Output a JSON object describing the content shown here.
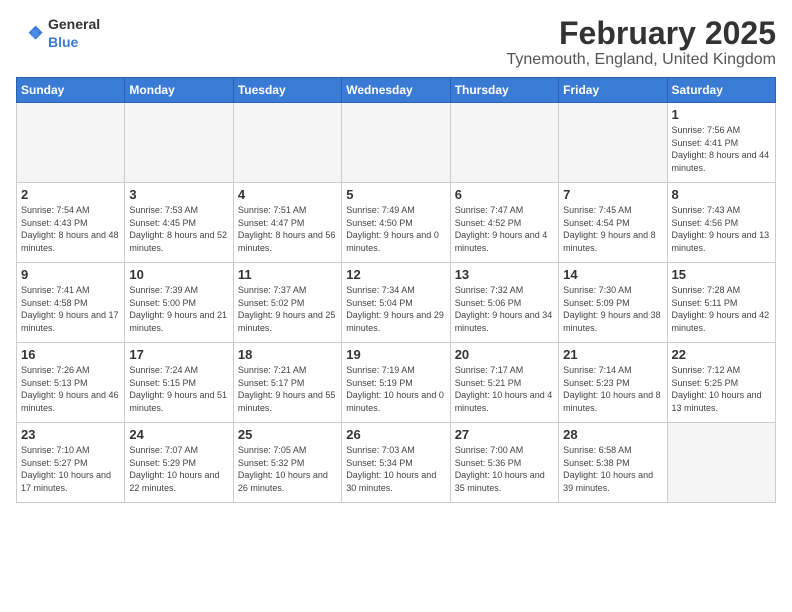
{
  "header": {
    "logo_general": "General",
    "logo_blue": "Blue",
    "title": "February 2025",
    "subtitle": "Tynemouth, England, United Kingdom"
  },
  "days_of_week": [
    "Sunday",
    "Monday",
    "Tuesday",
    "Wednesday",
    "Thursday",
    "Friday",
    "Saturday"
  ],
  "weeks": [
    [
      {
        "day": "",
        "info": ""
      },
      {
        "day": "",
        "info": ""
      },
      {
        "day": "",
        "info": ""
      },
      {
        "day": "",
        "info": ""
      },
      {
        "day": "",
        "info": ""
      },
      {
        "day": "",
        "info": ""
      },
      {
        "day": "1",
        "info": "Sunrise: 7:56 AM\nSunset: 4:41 PM\nDaylight: 8 hours and 44 minutes."
      }
    ],
    [
      {
        "day": "2",
        "info": "Sunrise: 7:54 AM\nSunset: 4:43 PM\nDaylight: 8 hours and 48 minutes."
      },
      {
        "day": "3",
        "info": "Sunrise: 7:53 AM\nSunset: 4:45 PM\nDaylight: 8 hours and 52 minutes."
      },
      {
        "day": "4",
        "info": "Sunrise: 7:51 AM\nSunset: 4:47 PM\nDaylight: 8 hours and 56 minutes."
      },
      {
        "day": "5",
        "info": "Sunrise: 7:49 AM\nSunset: 4:50 PM\nDaylight: 9 hours and 0 minutes."
      },
      {
        "day": "6",
        "info": "Sunrise: 7:47 AM\nSunset: 4:52 PM\nDaylight: 9 hours and 4 minutes."
      },
      {
        "day": "7",
        "info": "Sunrise: 7:45 AM\nSunset: 4:54 PM\nDaylight: 9 hours and 8 minutes."
      },
      {
        "day": "8",
        "info": "Sunrise: 7:43 AM\nSunset: 4:56 PM\nDaylight: 9 hours and 13 minutes."
      }
    ],
    [
      {
        "day": "9",
        "info": "Sunrise: 7:41 AM\nSunset: 4:58 PM\nDaylight: 9 hours and 17 minutes."
      },
      {
        "day": "10",
        "info": "Sunrise: 7:39 AM\nSunset: 5:00 PM\nDaylight: 9 hours and 21 minutes."
      },
      {
        "day": "11",
        "info": "Sunrise: 7:37 AM\nSunset: 5:02 PM\nDaylight: 9 hours and 25 minutes."
      },
      {
        "day": "12",
        "info": "Sunrise: 7:34 AM\nSunset: 5:04 PM\nDaylight: 9 hours and 29 minutes."
      },
      {
        "day": "13",
        "info": "Sunrise: 7:32 AM\nSunset: 5:06 PM\nDaylight: 9 hours and 34 minutes."
      },
      {
        "day": "14",
        "info": "Sunrise: 7:30 AM\nSunset: 5:09 PM\nDaylight: 9 hours and 38 minutes."
      },
      {
        "day": "15",
        "info": "Sunrise: 7:28 AM\nSunset: 5:11 PM\nDaylight: 9 hours and 42 minutes."
      }
    ],
    [
      {
        "day": "16",
        "info": "Sunrise: 7:26 AM\nSunset: 5:13 PM\nDaylight: 9 hours and 46 minutes."
      },
      {
        "day": "17",
        "info": "Sunrise: 7:24 AM\nSunset: 5:15 PM\nDaylight: 9 hours and 51 minutes."
      },
      {
        "day": "18",
        "info": "Sunrise: 7:21 AM\nSunset: 5:17 PM\nDaylight: 9 hours and 55 minutes."
      },
      {
        "day": "19",
        "info": "Sunrise: 7:19 AM\nSunset: 5:19 PM\nDaylight: 10 hours and 0 minutes."
      },
      {
        "day": "20",
        "info": "Sunrise: 7:17 AM\nSunset: 5:21 PM\nDaylight: 10 hours and 4 minutes."
      },
      {
        "day": "21",
        "info": "Sunrise: 7:14 AM\nSunset: 5:23 PM\nDaylight: 10 hours and 8 minutes."
      },
      {
        "day": "22",
        "info": "Sunrise: 7:12 AM\nSunset: 5:25 PM\nDaylight: 10 hours and 13 minutes."
      }
    ],
    [
      {
        "day": "23",
        "info": "Sunrise: 7:10 AM\nSunset: 5:27 PM\nDaylight: 10 hours and 17 minutes."
      },
      {
        "day": "24",
        "info": "Sunrise: 7:07 AM\nSunset: 5:29 PM\nDaylight: 10 hours and 22 minutes."
      },
      {
        "day": "25",
        "info": "Sunrise: 7:05 AM\nSunset: 5:32 PM\nDaylight: 10 hours and 26 minutes."
      },
      {
        "day": "26",
        "info": "Sunrise: 7:03 AM\nSunset: 5:34 PM\nDaylight: 10 hours and 30 minutes."
      },
      {
        "day": "27",
        "info": "Sunrise: 7:00 AM\nSunset: 5:36 PM\nDaylight: 10 hours and 35 minutes."
      },
      {
        "day": "28",
        "info": "Sunrise: 6:58 AM\nSunset: 5:38 PM\nDaylight: 10 hours and 39 minutes."
      },
      {
        "day": "",
        "info": ""
      }
    ]
  ]
}
